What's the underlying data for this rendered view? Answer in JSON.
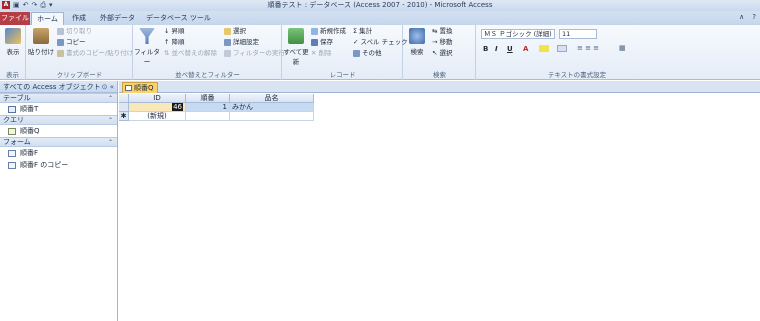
{
  "titlebar": {
    "app_icon": "A",
    "qat_icons": [
      "save-icon",
      "undo-icon",
      "redo-icon",
      "print-icon",
      "customize-icon"
    ],
    "title": "順番テスト : データベース (Access 2007 - 2010) - Microsoft Access"
  },
  "ribbon_tabs": [
    "ファイル",
    "ホーム",
    "作成",
    "外部データ",
    "データベース ツール"
  ],
  "ribbon": {
    "view": {
      "label": "表示",
      "group": "表示"
    },
    "clipboard": {
      "paste": "貼り付け",
      "cut": "切り取り",
      "copy": "コピー",
      "format_painter": "書式のコピー/貼り付け",
      "group": "クリップボード"
    },
    "sort_filter": {
      "filter": "フィルター",
      "ascending": "昇順",
      "descending": "降順",
      "clear_sort": "並べ替えの解除",
      "selection": "選択",
      "advanced": "詳細設定",
      "toggle_filter": "フィルターの実行",
      "group": "並べ替えとフィルター"
    },
    "records": {
      "refresh": "すべて更新",
      "new": "新規作成",
      "save": "保存",
      "delete": "削除",
      "totals": "集計",
      "spelling": "スペル チェック",
      "more": "その他",
      "group": "レコード"
    },
    "find": {
      "find": "検索",
      "replace": "置換",
      "goto": "移動",
      "select": "選択",
      "group": "検索"
    },
    "text_format": {
      "font": "ＭＳ Ｐゴシック (詳細)",
      "size": "11",
      "bold": "B",
      "italic": "I",
      "underline": "U",
      "font_color": "A",
      "group": "テキストの書式設定"
    }
  },
  "nav": {
    "header": "すべての Access オブジェクト",
    "sections": [
      {
        "label": "テーブル",
        "items": [
          "順番T"
        ]
      },
      {
        "label": "クエリ",
        "items": [
          "順番Q"
        ]
      },
      {
        "label": "フォーム",
        "items": [
          "順番F",
          "順番F のコピー"
        ]
      }
    ]
  },
  "document": {
    "tab": "順番Q",
    "columns": [
      "ID",
      "順番",
      "品名"
    ],
    "rows": [
      {
        "id": "46",
        "jun": "1",
        "name": "みかん"
      }
    ],
    "new_row": "(新規)"
  },
  "colors": {
    "file_tab": "#b53e46",
    "doc_tab": "#f9d26c",
    "selected_row": "#c6dbf3"
  }
}
